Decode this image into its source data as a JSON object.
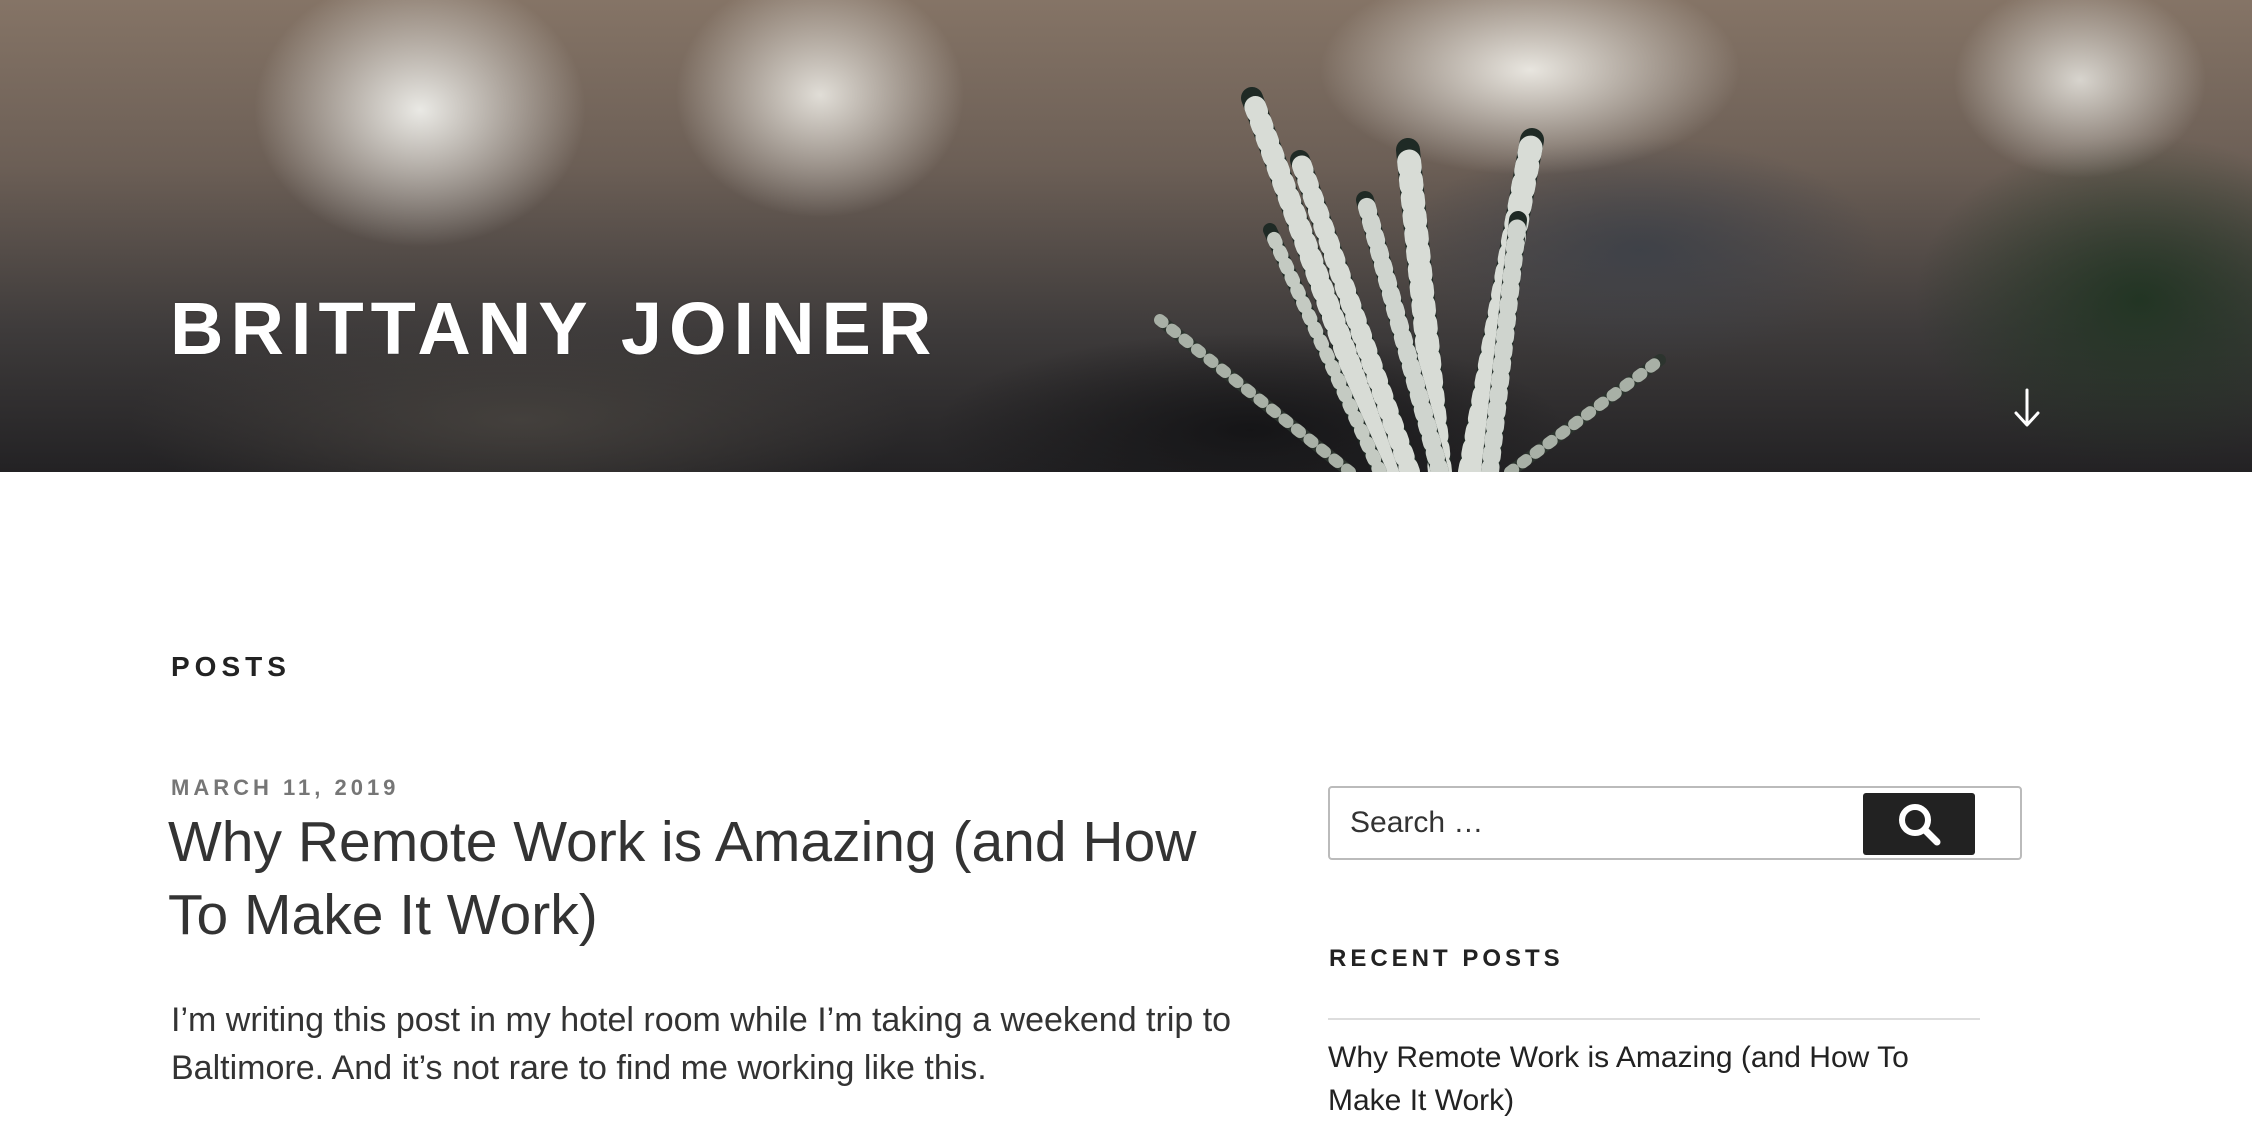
{
  "header": {
    "site_title": "BRITTANY JOINER",
    "scroll_icon": "arrow-down-icon"
  },
  "main": {
    "page_heading": "POSTS",
    "post": {
      "date": "MARCH 11, 2019",
      "title": "Why Remote Work is Amazing (and How To Make It Work)",
      "excerpt": "I’m writing this post in my hotel room while I’m taking a weekend trip to Baltimore. And it’s not rare to find me working like this."
    }
  },
  "sidebar": {
    "search": {
      "placeholder": "Search …",
      "button_icon": "search-icon"
    },
    "recent_posts": {
      "title": "RECENT POSTS",
      "items": [
        "Why Remote Work is Amazing (and How To Make It Work)"
      ]
    }
  },
  "colors": {
    "text": "#222222",
    "meta": "#767676",
    "button": "#222222",
    "white": "#ffffff"
  }
}
